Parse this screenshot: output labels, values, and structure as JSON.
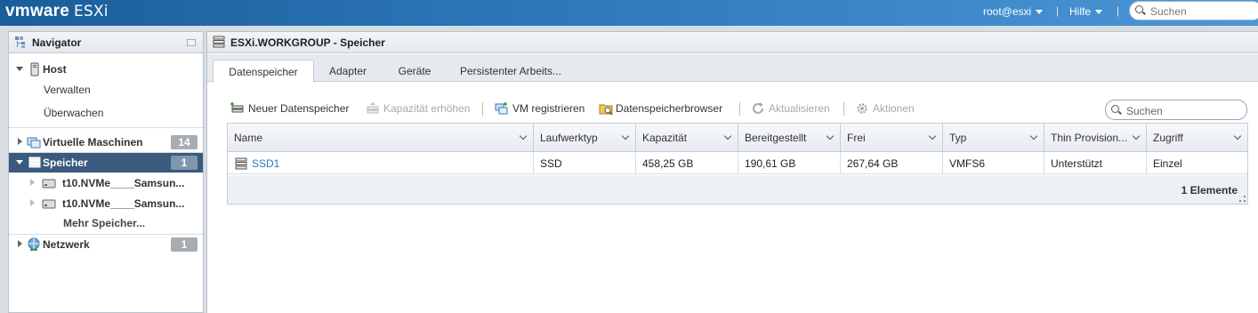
{
  "header": {
    "logo_vm": "vmware",
    "logo_product": "ESXi",
    "user_menu": "root@esxi",
    "sep": "|",
    "help_menu": "Hilfe",
    "search_placeholder": "Suchen"
  },
  "navigator": {
    "title": "Navigator",
    "items": [
      {
        "label": "Host",
        "icon": "host-icon"
      },
      {
        "label": "Verwalten"
      },
      {
        "label": "Überwachen"
      },
      {
        "label": "Virtuelle Maschinen",
        "icon": "vm-icon",
        "badge": "14"
      },
      {
        "label": "Speicher",
        "icon": "storage-icon",
        "badge": "1",
        "selected": true
      },
      {
        "label": "t10.NVMe____Samsun...",
        "icon": "disk-icon"
      },
      {
        "label": "t10.NVMe____Samsun...",
        "icon": "disk-icon"
      },
      {
        "label": "Mehr Speicher..."
      },
      {
        "label": "Netzwerk",
        "icon": "network-icon",
        "badge": "1"
      }
    ]
  },
  "main": {
    "title": "ESXi.WORKGROUP - Speicher",
    "tabs": [
      "Datenspeicher",
      "Adapter",
      "Geräte",
      "Persistenter Arbeits..."
    ],
    "active_tab": 0,
    "toolbar": {
      "new_datastore": "Neuer Datenspeicher",
      "increase_capacity": "Kapazität erhöhen",
      "register_vm": "VM registrieren",
      "datastore_browser": "Datenspeicherbrowser",
      "refresh": "Aktualisieren",
      "actions": "Aktionen"
    },
    "search_placeholder": "Suchen",
    "table": {
      "columns": [
        "Name",
        "Laufwerktyp",
        "Kapazität",
        "Bereitgestellt",
        "Frei",
        "Typ",
        "Thin Provision...",
        "Zugriff"
      ],
      "rows": [
        [
          "SSD1",
          "SSD",
          "458,25 GB",
          "190,61 GB",
          "267,64 GB",
          "VMFS6",
          "Unterstützt",
          "Einzel"
        ]
      ],
      "footer_count": "1 Elemente"
    }
  }
}
